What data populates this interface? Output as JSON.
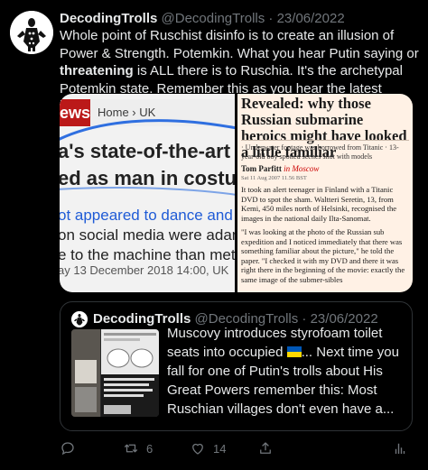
{
  "tweet": {
    "display_name": "DecodingTrolls",
    "handle": "@DecodingTrolls",
    "separator": "·",
    "date": "23/06/2022",
    "text_1": "Whole point of Ruschist disinfo is to create an illusion of Power & Strength. Potemkin. What you hear Putin saying or ",
    "text_bold": "threatening",
    "text_2": " is ALL there is to Ruschia. It's the archetypal Potemkin state. Remember this as you hear the latest breathless westerner falling for the troll."
  },
  "media_left": {
    "logo": "ews",
    "breadcrumb": "Home › UK",
    "headline_1": "a's state-of-the-art rob",
    "headline_2": "ed as man in costume",
    "body_1": "ot appeared to dance and spea",
    "body_2": "on social media were adamant t",
    "body_3": "e to the machine than met the",
    "date": "ay 13 December 2018 14:00, UK"
  },
  "media_right": {
    "headline": "Revealed: why those Russian submarine heroics might have looked a little familiar",
    "subhead": "· Underwater footage was borrowed from Titanic · 13-year-old boy spotted scenes shot with models",
    "byline_name": "Tom Parfitt",
    "byline_loc": "in Moscow",
    "dateline": "Sat 11 Aug 2007 11.56 BST",
    "para_1": "It took an alert teenager in Finland with a Titanic DVD to spot the sham. Waltteri Seretin, 13, from Kemi, 450 miles north of Helsinki, recognised the images in the national daily Ilta-Sanomat.",
    "para_2": "\"I was looking at the photo of the Russian sub expedition and I noticed immediately that there was something familiar about the picture,\" he told the paper. \"I checked it with my DVD and there it was right there in the beginning of the movie: exactly the same image of the submer-sibles"
  },
  "quote": {
    "display_name": "DecodingTrolls",
    "handle": "@DecodingTrolls",
    "separator": "·",
    "date": "23/06/2022",
    "text_1": "Muscovy introduces styrofoam toilet seats into occupied ",
    "text_2": "... Next time you fall for one of Putin's trolls about His Great Powers remember this: Most Ruschian villages don't even have a..."
  },
  "actions": {
    "reply_count": "",
    "retweet_count": "6",
    "like_count": "14"
  },
  "colors": {
    "flag_blue": "#0057b7",
    "flag_yellow": "#ffd700",
    "news_red": "#bb1919",
    "guardian_red": "#cc0000"
  }
}
